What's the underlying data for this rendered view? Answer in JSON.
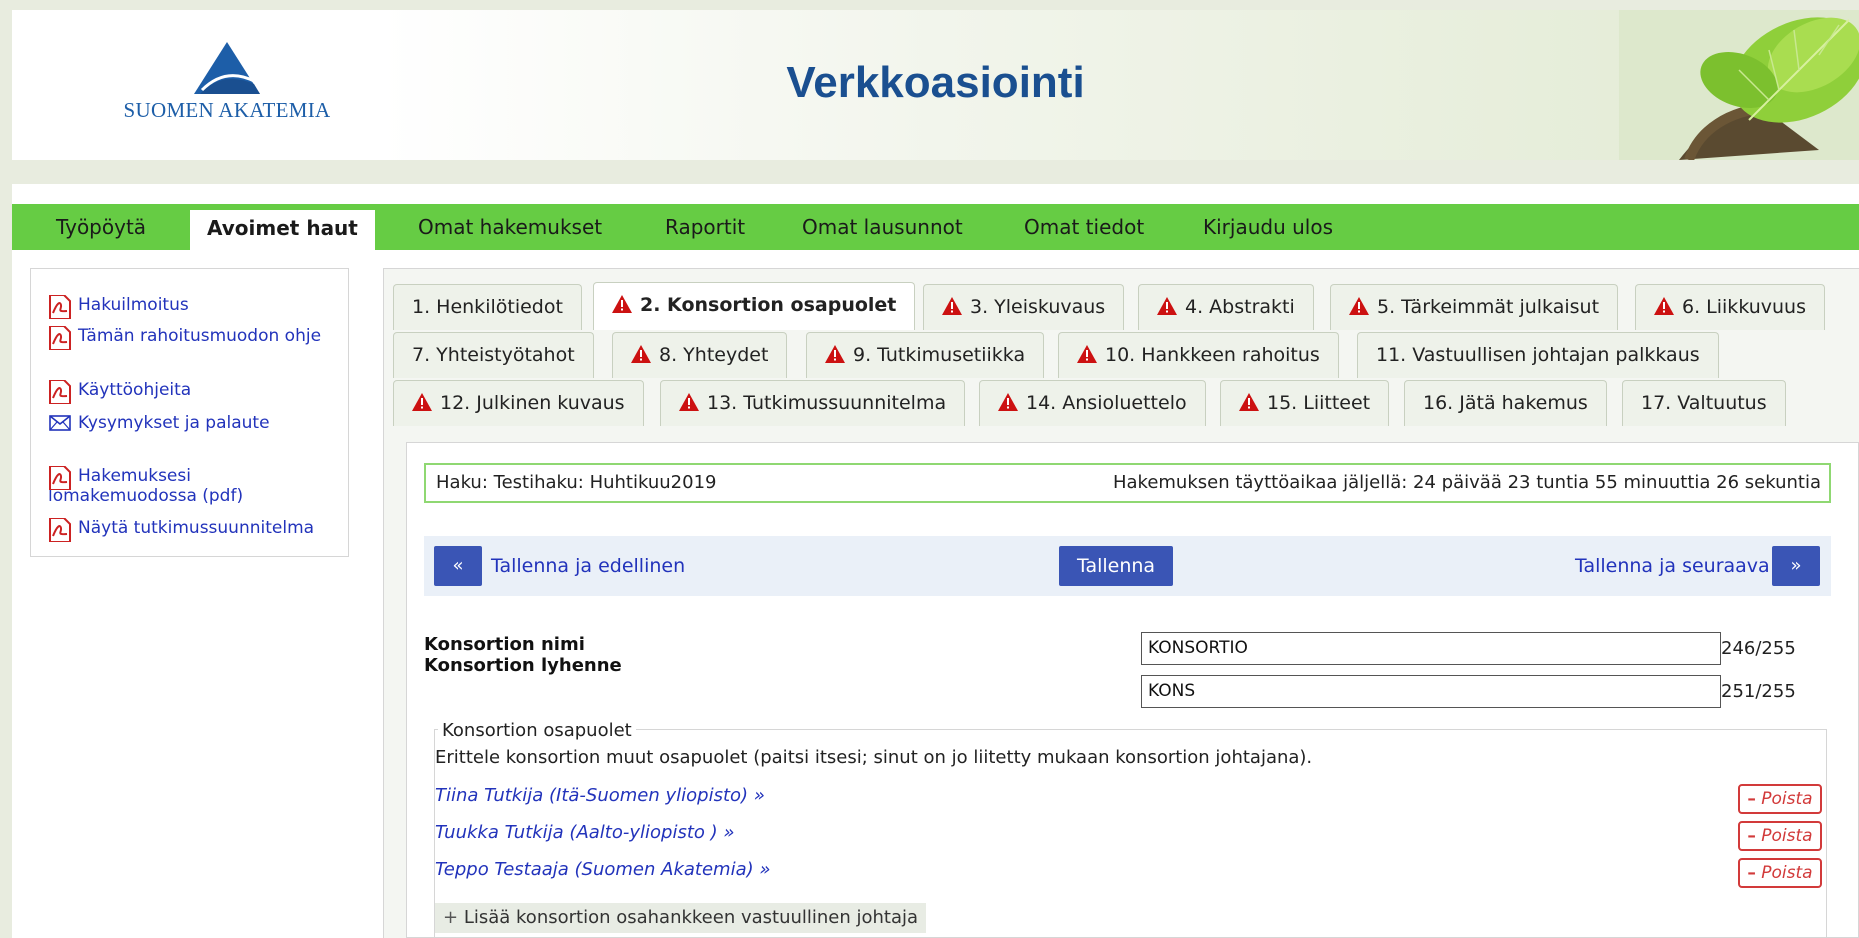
{
  "header": {
    "logo_text": "SUOMEN AKATEMIA",
    "app_title": "Verkkoasiointi"
  },
  "nav": {
    "items": [
      {
        "label": "Työpöytä"
      },
      {
        "label": "Avoimet haut"
      },
      {
        "label": "Omat hakemukset"
      },
      {
        "label": "Raportit"
      },
      {
        "label": "Omat lausunnot"
      },
      {
        "label": "Omat tiedot"
      },
      {
        "label": "Kirjaudu ulos"
      }
    ],
    "active_index": 1,
    "color": "#66cc44"
  },
  "sidebar": {
    "links": [
      {
        "label": "Hakuilmoitus",
        "icon": "pdf-icon"
      },
      {
        "label": "Tämän rahoitusmuodon ohje",
        "icon": "pdf-icon"
      },
      {
        "label": "Käyttöohjeita",
        "icon": "pdf-icon"
      },
      {
        "label": "Kysymykset ja palaute",
        "icon": "envelope-icon"
      },
      {
        "label": "Hakemuksesi lomakemuodossa (pdf)",
        "icon": "pdf-icon"
      },
      {
        "label": "Näytä tutkimussuunnitelma",
        "icon": "pdf-icon"
      }
    ]
  },
  "tabs": [
    {
      "label": "1. Henkilötiedot",
      "warning": false
    },
    {
      "label": "2. Konsortion osapuolet",
      "warning": true
    },
    {
      "label": "3. Yleiskuvaus",
      "warning": true
    },
    {
      "label": "4. Abstrakti",
      "warning": true
    },
    {
      "label": "5. Tärkeimmät julkaisut",
      "warning": true
    },
    {
      "label": "6. Liikkuvuus",
      "warning": true
    },
    {
      "label": "7. Yhteistyötahot",
      "warning": false
    },
    {
      "label": "8. Yhteydet",
      "warning": true
    },
    {
      "label": "9. Tutkimusetiikka",
      "warning": true
    },
    {
      "label": "10. Hankkeen rahoitus",
      "warning": true
    },
    {
      "label": "11. Vastuullisen johtajan palkkaus",
      "warning": false
    },
    {
      "label": "12. Julkinen kuvaus",
      "warning": true
    },
    {
      "label": "13. Tutkimussuunnitelma",
      "warning": true
    },
    {
      "label": "14. Ansioluettelo",
      "warning": true
    },
    {
      "label": "15. Liitteet",
      "warning": true
    },
    {
      "label": "16. Jätä hakemus",
      "warning": false
    },
    {
      "label": "17. Valtuutus",
      "warning": false
    }
  ],
  "haku": {
    "left": "Haku: Testihaku: Huhtikuu2019",
    "right": "Hakemuksen täyttöaikaa jäljellä: 24 päivää 23 tuntia 55 minuuttia 26 sekuntia"
  },
  "savebar": {
    "prev_symbol": "«",
    "prev_label": "Tallenna ja edellinen",
    "save_label": "Tallenna",
    "next_label": "Tallenna ja seuraava",
    "next_symbol": "»"
  },
  "form": {
    "name_label": "Konsortion nimi",
    "abbr_label": "Konsortion lyhenne",
    "name_value": "KONSORTIO",
    "name_counter": "246/255",
    "abbr_value": "KONS",
    "abbr_counter": "251/255"
  },
  "members": {
    "legend": "Konsortion osapuolet",
    "description": "Erittele konsortion muut osapuolet (paitsi itsesi; sinut on jo liitetty mukaan konsortion johtajana).",
    "items": [
      {
        "label": "Tiina Tutkija (Itä-Suomen yliopisto) »"
      },
      {
        "label": "Tuukka Tutkija (Aalto-yliopisto ) »"
      },
      {
        "label": "Teppo Testaaja (Suomen Akatemia) »"
      }
    ],
    "delete_label": "Poista",
    "delete_symbol": "–",
    "add_label": "Lisää konsortion osahankkeen vastuullinen johtaja",
    "add_symbol": "+"
  }
}
